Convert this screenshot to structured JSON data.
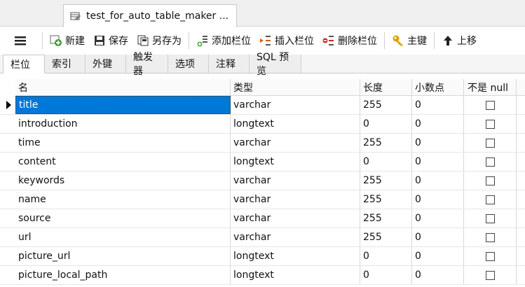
{
  "tab": {
    "title": "test_for_auto_table_maker ..."
  },
  "toolbar": {
    "new_label": "新建",
    "save_label": "保存",
    "save_as_label": "另存为",
    "add_field_label": "添加栏位",
    "insert_field_label": "插入栏位",
    "delete_field_label": "删除栏位",
    "primary_key_label": "主键",
    "move_up_label": "上移"
  },
  "subtabs": [
    "栏位",
    "索引",
    "外键",
    "触发器",
    "选项",
    "注释",
    "SQL 预览"
  ],
  "columns": {
    "name": "名",
    "type": "类型",
    "length": "长度",
    "decimals": "小数点",
    "not_null": "不是 null"
  },
  "rows": [
    {
      "name": "title",
      "type": "varchar",
      "length": "255",
      "decimals": "0",
      "not_null": false
    },
    {
      "name": "introduction",
      "type": "longtext",
      "length": "0",
      "decimals": "0",
      "not_null": false
    },
    {
      "name": "time",
      "type": "varchar",
      "length": "255",
      "decimals": "0",
      "not_null": false
    },
    {
      "name": "content",
      "type": "longtext",
      "length": "0",
      "decimals": "0",
      "not_null": false
    },
    {
      "name": "keywords",
      "type": "varchar",
      "length": "255",
      "decimals": "0",
      "not_null": false
    },
    {
      "name": "name",
      "type": "varchar",
      "length": "255",
      "decimals": "0",
      "not_null": false
    },
    {
      "name": "source",
      "type": "varchar",
      "length": "255",
      "decimals": "0",
      "not_null": false
    },
    {
      "name": "url",
      "type": "varchar",
      "length": "255",
      "decimals": "0",
      "not_null": false
    },
    {
      "name": "picture_url",
      "type": "longtext",
      "length": "0",
      "decimals": "0",
      "not_null": false
    },
    {
      "name": "picture_local_path",
      "type": "longtext",
      "length": "0",
      "decimals": "0",
      "not_null": false
    }
  ],
  "selected_row": 0,
  "colors": {
    "selection": "#0078d7",
    "add_icon": "#3a9a2a",
    "delete_icon": "#cc2222",
    "key_icon": "#e0a000"
  }
}
